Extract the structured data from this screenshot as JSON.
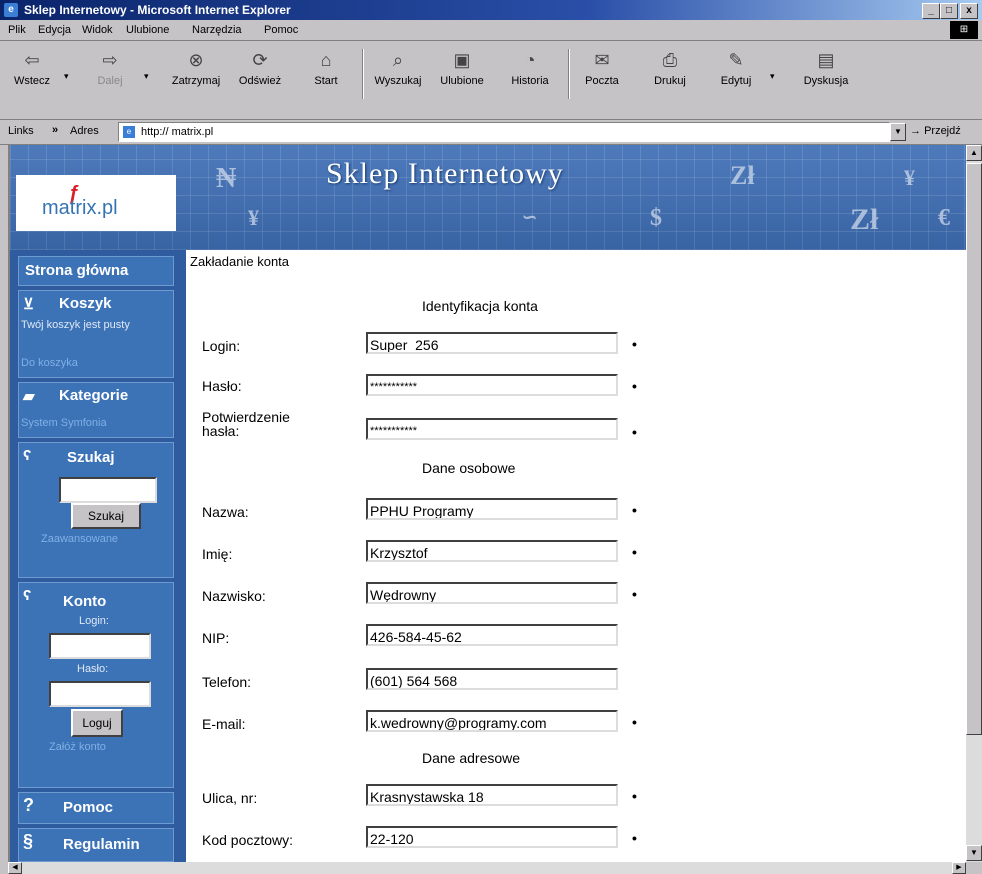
{
  "window": {
    "title": "Sklep Internetowy - Microsoft Internet Explorer"
  },
  "menu": [
    "Plik",
    "Edycja",
    "Widok",
    "Ulubione",
    "Narzędzia",
    "Pomoc"
  ],
  "toolbar": {
    "back": "Wstecz",
    "forward": "Dalej",
    "stop": "Zatrzymaj",
    "refresh": "Odśwież",
    "home": "Start",
    "search": "Wyszukaj",
    "favorites": "Ulubione",
    "history": "Historia",
    "mail": "Poczta",
    "print": "Drukuj",
    "edit": "Edytuj",
    "discuss": "Dyskusja"
  },
  "addressbar": {
    "links": "Links",
    "label": "Adres",
    "url": "http:// matrix.pl",
    "go": "Przejdź"
  },
  "banner": {
    "title": "Sklep Internetowy",
    "logo": "matrix.pl"
  },
  "sidebar": {
    "home": "Strona główna",
    "cart_title": "Koszyk",
    "cart_status": "Twój koszyk jest pusty",
    "cart_link": "Do koszyka",
    "categories_title": "Kategorie",
    "categories_item": "System Symfonia",
    "search_title": "Szukaj",
    "search_button": "Szukaj",
    "search_advanced": "Zaawansowane",
    "account_title": "Konto",
    "login_label": "Login:",
    "password_label": "Hasło:",
    "login_button": "Loguj",
    "register_link": "Załóż konto",
    "help": "Pomoc",
    "rules": "Regulamin"
  },
  "form": {
    "page_title": "Zakładanie konta",
    "sections": {
      "identification": "Identyfikacja konta",
      "personal": "Dane osobowe",
      "address": "Dane adresowe"
    },
    "labels": {
      "login": "Login:",
      "password": "Hasło:",
      "confirm_line1": "Potwierdzenie",
      "confirm_line2": "hasła:",
      "name": "Nazwa:",
      "first_name": "Imię:",
      "last_name": "Nazwisko:",
      "nip": "NIP:",
      "phone": "Telefon:",
      "email": "E-mail:",
      "street": "Ulica, nr:",
      "postal": "Kod pocztowy:"
    },
    "values": {
      "login": "Super_256",
      "password": "***********",
      "confirm": "***********",
      "name": "PPHU Programy",
      "first_name": "Krzysztof",
      "last_name": "Wędrowny",
      "nip": "426-584-45-62",
      "phone": "(601) 564 568",
      "email": "k.wedrowny@programy.com",
      "street": "Krasnystawska 18",
      "postal": "22-120"
    },
    "required_mark": "•"
  }
}
